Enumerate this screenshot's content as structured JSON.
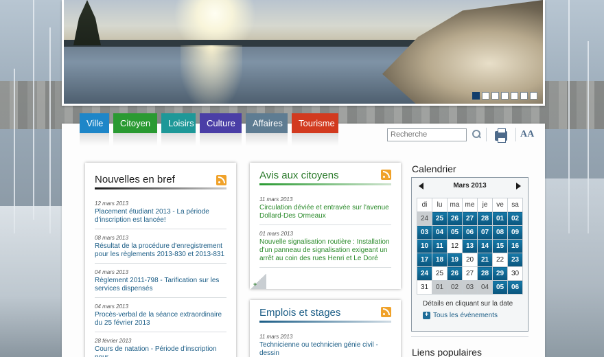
{
  "banner": {
    "slides": 7,
    "active_slide": 1
  },
  "nav": {
    "tabs": [
      {
        "label": "Ville",
        "color": "#1e86c8"
      },
      {
        "label": "Citoyen",
        "color": "#2a9a32"
      },
      {
        "label": "Loisirs",
        "color": "#1e9898"
      },
      {
        "label": "Culture",
        "color": "#4a3ea6"
      },
      {
        "label": "Affaires",
        "color": "#5e7c92"
      },
      {
        "label": "Tourisme",
        "color": "#d23a1f"
      }
    ]
  },
  "tools": {
    "search_placeholder": "Recherche",
    "search_icon": "search-icon",
    "print_icon": "print-icon",
    "font_size_label": "AA"
  },
  "news": {
    "title": "Nouvelles en bref",
    "link_color": "#1b5d86",
    "items": [
      {
        "date": "12 mars 2013",
        "text": "Placement étudiant 2013 - La période d'inscription est lancée!"
      },
      {
        "date": "08 mars 2013",
        "text": "Résultat de la procédure d'enregistrement pour les règlements 2013-830 et 2013-831"
      },
      {
        "date": "04 mars 2013",
        "text": "Règlement 2011-798 - Tarification sur les services dispensés"
      },
      {
        "date": "04 mars 2013",
        "text": "Procès-verbal de la séance extraordinaire du 25 février 2013"
      },
      {
        "date": "28 février 2013",
        "text": "Cours de natation - Période d'inscription pour"
      }
    ]
  },
  "notices": {
    "title": "Avis aux citoyens",
    "link_color": "#2a8a2a",
    "items": [
      {
        "date": "11 mars 2013",
        "text": "Circulation déviée et entravée sur l'avenue Dollard-Des Ormeaux"
      },
      {
        "date": "01 mars 2013",
        "text": "Nouvelle signalisation routière : Installation d'un panneau de signalisation exigeant un arrêt au coin des rues Henri et Le Doré"
      }
    ],
    "more_label": "+"
  },
  "jobs": {
    "title": "Emplois et stages",
    "link_color": "#1b5d86",
    "items": [
      {
        "date": "11 mars 2013",
        "text": "Technicienne ou technicien génie civil - dessin"
      }
    ]
  },
  "calendar": {
    "heading": "Calendrier",
    "month": "Mars 2013",
    "days": [
      "di",
      "lu",
      "ma",
      "me",
      "je",
      "ve",
      "sa"
    ],
    "weeks": [
      [
        [
          "24",
          "o"
        ],
        [
          "25",
          "e"
        ],
        [
          "26",
          "e"
        ],
        [
          "27",
          "e"
        ],
        [
          "28",
          "e"
        ],
        [
          "01",
          "e"
        ],
        [
          "02",
          "e"
        ]
      ],
      [
        [
          "03",
          "e"
        ],
        [
          "04",
          "e"
        ],
        [
          "05",
          "e"
        ],
        [
          "06",
          "e"
        ],
        [
          "07",
          "e"
        ],
        [
          "08",
          "e"
        ],
        [
          "09",
          "e"
        ]
      ],
      [
        [
          "10",
          "e"
        ],
        [
          "11",
          "e"
        ],
        [
          "12",
          "w"
        ],
        [
          "13",
          "e"
        ],
        [
          "14",
          "e"
        ],
        [
          "15",
          "e"
        ],
        [
          "16",
          "e"
        ]
      ],
      [
        [
          "17",
          "e"
        ],
        [
          "18",
          "e"
        ],
        [
          "19",
          "e"
        ],
        [
          "20",
          "w"
        ],
        [
          "21",
          "e"
        ],
        [
          "22",
          "w"
        ],
        [
          "23",
          "e"
        ]
      ],
      [
        [
          "24",
          "e"
        ],
        [
          "25",
          "w"
        ],
        [
          "26",
          "e"
        ],
        [
          "27",
          "w"
        ],
        [
          "28",
          "e"
        ],
        [
          "29",
          "e"
        ],
        [
          "30",
          "w"
        ]
      ],
      [
        [
          "31",
          "w"
        ],
        [
          "01",
          "o"
        ],
        [
          "02",
          "o"
        ],
        [
          "03",
          "o"
        ],
        [
          "04",
          "o"
        ],
        [
          "05",
          "e"
        ],
        [
          "06",
          "e"
        ]
      ]
    ],
    "note": "Détails en cliquant sur la date",
    "all_events": "Tous les événements"
  },
  "popular": {
    "heading": "Liens populaires"
  }
}
